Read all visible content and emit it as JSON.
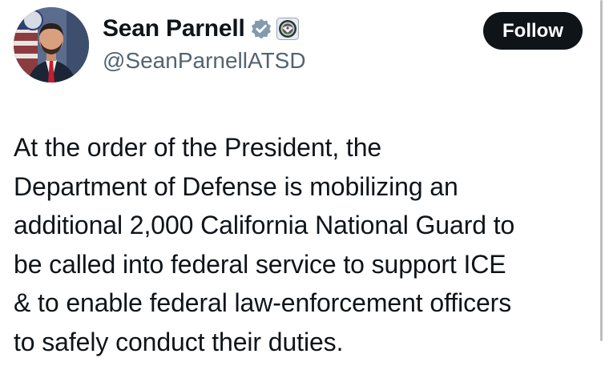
{
  "tweet": {
    "author": {
      "name": "Sean Parnell",
      "handle": "@SeanParnellATSD",
      "verified_badge_icon": "verified-badge-icon",
      "affiliation_icon": "department-of-defense-seal-icon",
      "avatar_icon": "profile-photo-avatar"
    },
    "follow_label": "Follow",
    "text": "At the order of the President, the\nDepartment of Defense is mobilizing an\nadditional 2,000 California National Guard to\nbe called into federal service to support ICE\n& to enable federal law-enforcement officers\nto safely conduct their duties."
  },
  "colors": {
    "text_primary": "#0f1419",
    "text_secondary": "#536471",
    "button_bg": "#0f1419",
    "button_text": "#ffffff",
    "badge_gray": "#829aab"
  }
}
